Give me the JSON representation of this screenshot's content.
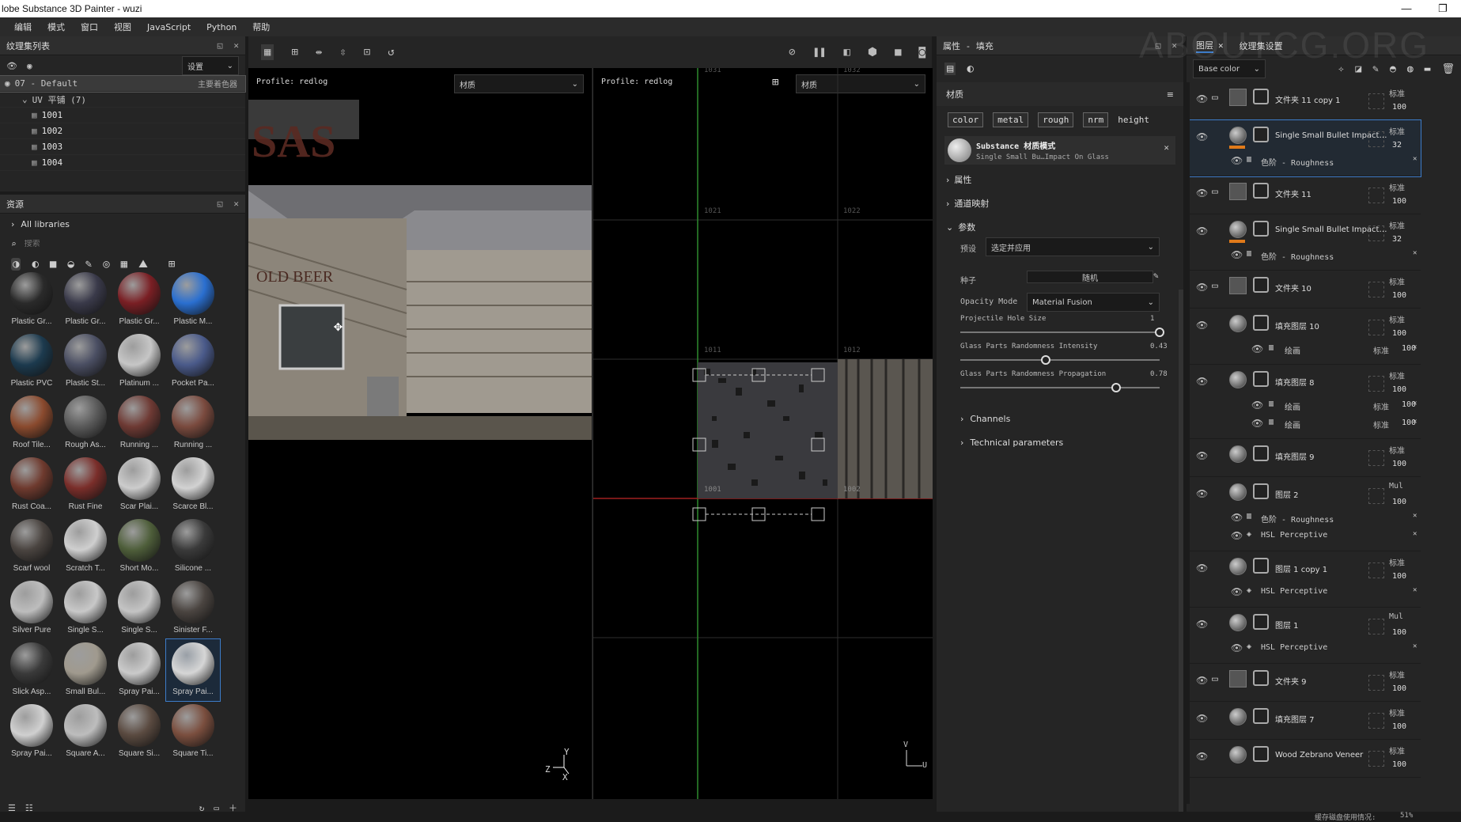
{
  "titlebar": {
    "title": "lobe Substance 3D Painter - wuzi",
    "min": "—",
    "max": "❐"
  },
  "menu": [
    "编辑",
    "模式",
    "窗口",
    "视图",
    "JavaScript",
    "Python",
    "帮助"
  ],
  "texset": {
    "title": "纹理集列表",
    "settings": "设置",
    "default": "07 - Default",
    "main_shader": "主要着色器",
    "uv": "UV 平铺 (7)",
    "tiles": [
      "1001",
      "1002",
      "1003",
      "1004"
    ]
  },
  "assets": {
    "title": "资源",
    "libs": "All libraries",
    "search_placeholder": "搜索",
    "items": [
      {
        "label": "Plastic Gr...",
        "color": "#2a2a2a"
      },
      {
        "label": "Plastic Gr...",
        "color": "#3a3a4a"
      },
      {
        "label": "Plastic Gr...",
        "color": "#7a1f24"
      },
      {
        "label": "Plastic M...",
        "color": "#2a6fd0"
      },
      {
        "label": "Plastic PVC",
        "color": "#1c3a4e"
      },
      {
        "label": "Plastic St...",
        "color": "#4a4e62"
      },
      {
        "label": "Platinum ...",
        "color": "#c6c6c6"
      },
      {
        "label": "Pocket Pa...",
        "color": "#4a5a8a"
      },
      {
        "label": "Roof Tile...",
        "color": "#8a4a2e"
      },
      {
        "label": "Rough As...",
        "color": "#5a5a5a"
      },
      {
        "label": "Running ...",
        "color": "#6e3a34"
      },
      {
        "label": "Running ...",
        "color": "#7a4a3e"
      },
      {
        "label": "Rust Coa...",
        "color": "#6e3a2e"
      },
      {
        "label": "Rust Fine",
        "color": "#7a2e2a"
      },
      {
        "label": "Scar Plai...",
        "color": "#cccccc"
      },
      {
        "label": "Scarce Bl...",
        "color": "#d2d2d2"
      },
      {
        "label": "Scarf wool",
        "color": "#4a4440"
      },
      {
        "label": "Scratch T...",
        "color": "#cfcfcf"
      },
      {
        "label": "Short Mo...",
        "color": "#4e5e3a"
      },
      {
        "label": "Silicone ...",
        "color": "#3a3a3a"
      },
      {
        "label": "Silver Pure",
        "color": "#bdbdbd"
      },
      {
        "label": "Single S...",
        "color": "#c8c8c8"
      },
      {
        "label": "Single S...",
        "color": "#c4c4c4"
      },
      {
        "label": "Sinister F...",
        "color": "#4a4440"
      },
      {
        "label": "Slick Asp...",
        "color": "#3a3a3a"
      },
      {
        "label": "Small Bul...",
        "color": "#a09a8e"
      },
      {
        "label": "Spray Pai...",
        "color": "#cacaca"
      },
      {
        "label": "Spray Pai...",
        "color": "#d6d6d6"
      },
      {
        "label": "Spray Pai...",
        "color": "#d0d0d0"
      },
      {
        "label": "Square A...",
        "color": "#bdbdbd"
      },
      {
        "label": "Square Si...",
        "color": "#5a4a40"
      },
      {
        "label": "Square Ti...",
        "color": "#7a4e3e"
      }
    ]
  },
  "viewport3d": {
    "profile": "Profile: redlog",
    "mode": "材质"
  },
  "viewport2d": {
    "profile": "Profile: redlog",
    "mode": "材质",
    "tiles": [
      "1031",
      "1032",
      "1021",
      "1022",
      "1011",
      "1012",
      "1001",
      "1002"
    ],
    "axis_u": "U",
    "axis_v": "V"
  },
  "axes3d": {
    "y": "Y",
    "z": "Z",
    "x": "X"
  },
  "props": {
    "title": "属性 - 填充",
    "material": "材质",
    "channels": [
      "color",
      "metal",
      "rough",
      "nrm",
      "height"
    ],
    "substance_title": "Substance 材质模式",
    "substance_sub": "Single Small Bu…Impact On Glass",
    "sections": [
      "属性",
      "通道映射",
      "参数"
    ],
    "preset_label": "预设",
    "preset_value": "选定并应用",
    "seed_label": "种子",
    "seed_value": "随机",
    "opacity_label": "Opacity Mode",
    "opacity_value": "Material Fusion",
    "params": [
      {
        "label": "Projectile Hole Size",
        "value": "1",
        "frac": 1.0
      },
      {
        "label": "Glass Parts Randomness Intensity",
        "value": "0.43",
        "frac": 0.43
      },
      {
        "label": "Glass Parts Randomness Propagation",
        "value": "0.78",
        "frac": 0.78
      }
    ],
    "subsections": [
      "Channels",
      "Technical parameters"
    ]
  },
  "layers": {
    "tab1": "图层",
    "tab2": "纹理集设置",
    "channel": "Base color",
    "rows": [
      {
        "name": "文件夹 11 copy 1",
        "blend": "标准",
        "val": "100",
        "folder": true
      },
      {
        "name": "Single Small Bullet Impact…",
        "blend": "标准",
        "val": "32",
        "selected": true,
        "sub": "色阶 - Roughness"
      },
      {
        "name": "文件夹 11",
        "blend": "标准",
        "val": "100",
        "folder": true
      },
      {
        "name": "Single Small Bullet Impact…",
        "blend": "标准",
        "val": "32",
        "sub": "色阶 - Roughness"
      },
      {
        "name": "文件夹 10",
        "blend": "标准",
        "val": "100",
        "folder": true
      },
      {
        "name": "填充图层 10",
        "blend": "标准",
        "val": "100",
        "sub": "绘画",
        "subblend": "标准",
        "subval": "100"
      },
      {
        "name": "填充图层 8",
        "blend": "标准",
        "val": "100",
        "sub": "绘画",
        "sub2": "绘画",
        "subblend": "标准",
        "subval": "100"
      },
      {
        "name": "填充图层 9",
        "blend": "标准",
        "val": "100"
      },
      {
        "name": "图层 2",
        "blend": "Mul",
        "val": "100",
        "sub": "色阶 - Roughness",
        "sub2": "HSL Perceptive"
      },
      {
        "name": "图层 1 copy 1",
        "blend": "标准",
        "val": "100",
        "sub": "HSL Perceptive"
      },
      {
        "name": "图层 1",
        "blend": "Mul",
        "val": "100",
        "sub": "HSL Perceptive"
      },
      {
        "name": "文件夹 9",
        "blend": "标准",
        "val": "100",
        "folder": true
      },
      {
        "name": "填充图层 7",
        "blend": "标准",
        "val": "100"
      },
      {
        "name": "Wood Zebrano Veneer",
        "blend": "标准",
        "val": "100"
      }
    ]
  },
  "status": {
    "disk": "缓存磁盘使用情况:",
    "pct": "51%"
  },
  "watermark": "ABOUTCG.ORG"
}
